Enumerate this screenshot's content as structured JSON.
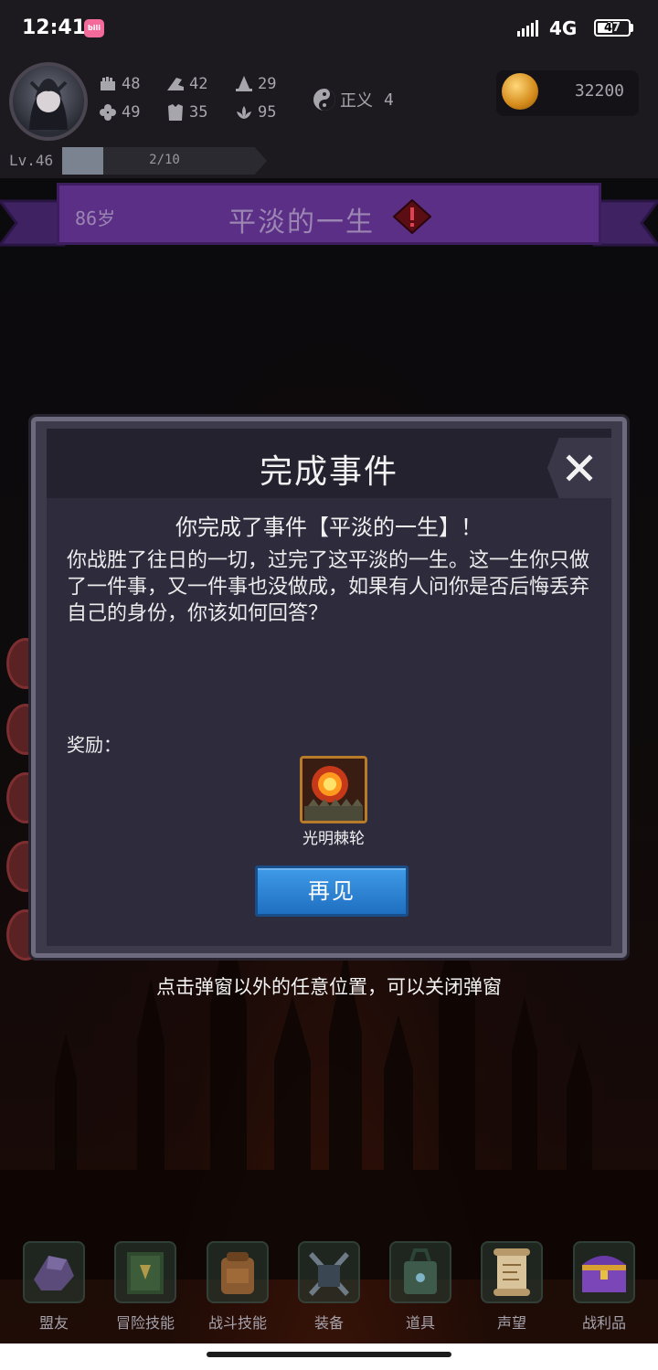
{
  "status_bar": {
    "time": "12:41",
    "app_badge": "bilibili",
    "network": "4G",
    "battery": "47"
  },
  "player": {
    "stats": [
      {
        "icon": "fist-icon",
        "value": "48"
      },
      {
        "icon": "boot-icon",
        "value": "42"
      },
      {
        "icon": "wizard-hat-icon",
        "value": "29"
      },
      {
        "icon": "clover-icon",
        "value": "49"
      },
      {
        "icon": "armor-icon",
        "value": "35"
      },
      {
        "icon": "lotus-icon",
        "value": "95"
      }
    ],
    "alignment": {
      "label": "正义",
      "value": "4"
    },
    "gold": "32200",
    "level": "Lv.46",
    "xp": {
      "text": "2/10",
      "progress": 0.2
    }
  },
  "event_banner": {
    "age": "86岁",
    "title": "平淡的一生"
  },
  "dialog": {
    "title": "完成事件",
    "subtitle": "你完成了事件【平淡的一生】！",
    "body": "你战胜了往日的一切，过完了这平淡的一生。这一生你只做了一件事，又一件事也没做成，如果有人问你是否后悔丢弃自己的身份，你该如何回答？",
    "reward_label": "奖励：",
    "reward_item_name": "光明棘轮",
    "confirm_button": "再见"
  },
  "hint": "点击弹窗以外的任意位置，可以关闭弹窗",
  "nav": [
    {
      "label": "盟友",
      "icon": "glove-icon"
    },
    {
      "label": "冒险技能",
      "icon": "book-icon"
    },
    {
      "label": "战斗技能",
      "icon": "backpack-icon"
    },
    {
      "label": "装备",
      "icon": "crossed-swords-icon"
    },
    {
      "label": "道具",
      "icon": "satchel-icon"
    },
    {
      "label": "声望",
      "icon": "scroll-icon"
    },
    {
      "label": "战利品",
      "icon": "treasure-chest-icon"
    }
  ]
}
